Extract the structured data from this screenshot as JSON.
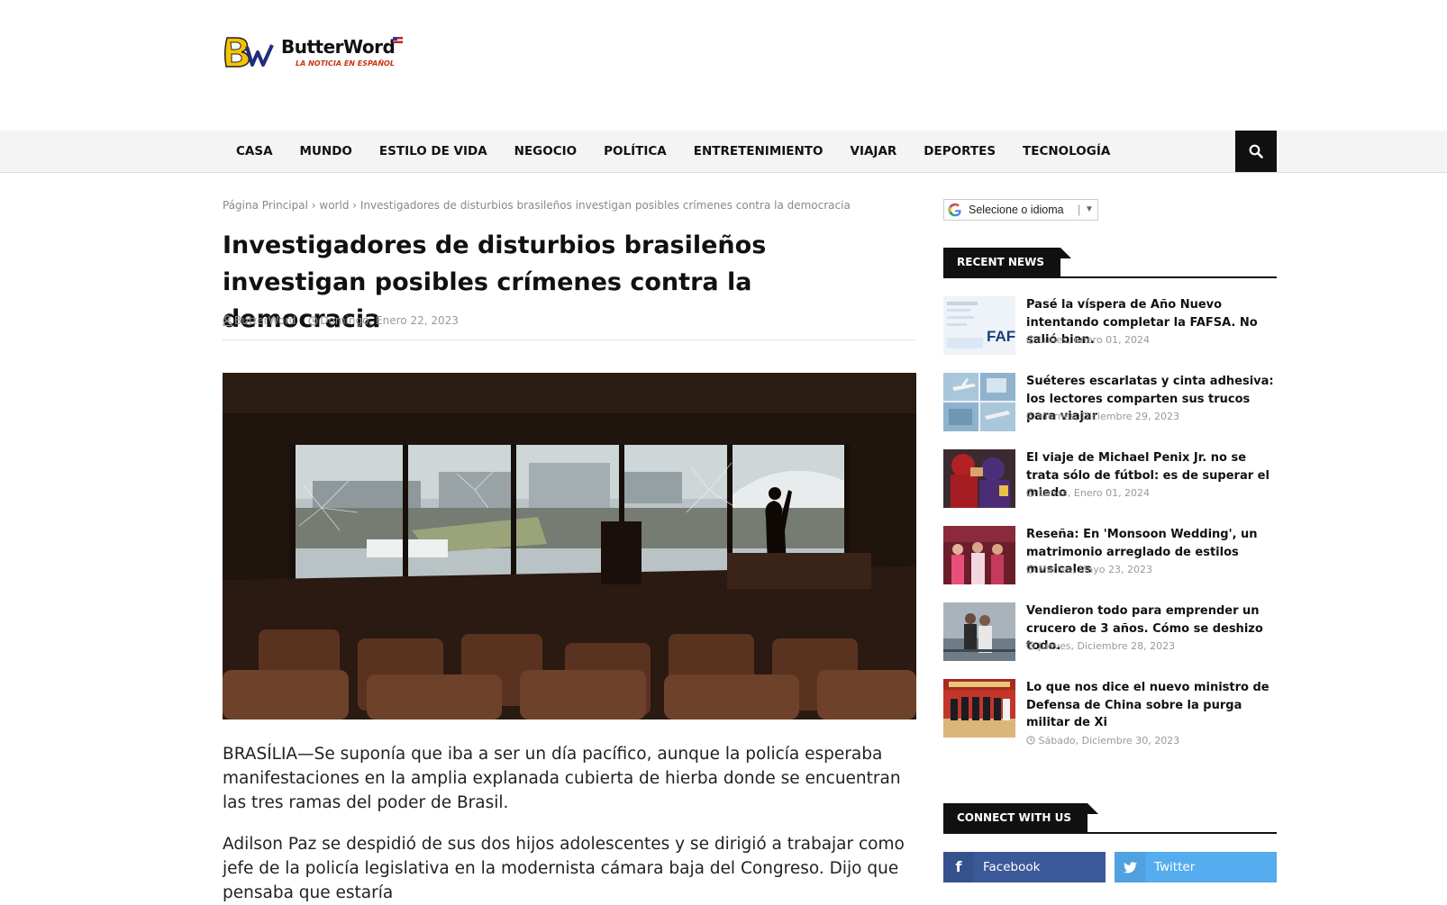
{
  "site": {
    "name": "ButterWord",
    "tagline": "LA NOTICIA EN ESPAÑOL"
  },
  "nav": {
    "items": [
      "CASA",
      "MUNDO",
      "ESTILO DE VIDA",
      "NEGOCIO",
      "POLÍTICA",
      "ENTRETENIMIENTO",
      "VIAJAR",
      "DEPORTES",
      "TECNOLOGÍA"
    ],
    "search_icon": "search-icon"
  },
  "breadcrumb": {
    "home": "Página Principal",
    "section": "world",
    "current": "Investigadores de disturbios brasileños investigan posibles crímenes contra la democracia"
  },
  "article": {
    "title": "Investigadores de disturbios brasileños investigan posibles crímenes contra la democracia",
    "author": "ButterWord",
    "date": "Domingo, Enero 22, 2023",
    "paragraphs": [
      "BRASÍLIA—Se suponía que iba a ser un día pacífico, aunque la policía esperaba manifestaciones en la amplia explanada cubierta de hierba donde se encuentran las tres ramas del poder de Brasil.",
      "Adilson Paz se despidió de sus dos hijos adolescentes y se dirigió a trabajar como jefe de la policía legislativa en la modernista cámara baja del Congreso. Dijo que pensaba que estaría"
    ]
  },
  "sidebar": {
    "translate_label": "Selecione o idioma",
    "recent_heading": "RECENT NEWS",
    "recent": [
      {
        "title": "Pasé la víspera de Año Nuevo intentando completar la FAFSA. No salió bien.",
        "date": "Lunes, Enero 01, 2024"
      },
      {
        "title": "Suéteres escarlatas y cinta adhesiva: los lectores comparten sus trucos para viajar",
        "date": "Viernes, Diciembre 29, 2023"
      },
      {
        "title": "El viaje de Michael Penix Jr. no se trata sólo de fútbol: es de superar el miedo",
        "date": "Lunes, Enero 01, 2024"
      },
      {
        "title": "Reseña: En 'Monsoon Wedding', un matrimonio arreglado de estilos musicales",
        "date": "Martes, Mayo 23, 2023"
      },
      {
        "title": "Vendieron todo para emprender un crucero de 3 años. Cómo se deshizo todo.",
        "date": "Jueves, Diciembre 28, 2023"
      },
      {
        "title": "Lo que nos dice el nuevo ministro de Defensa de China sobre la purga militar de Xi",
        "date": "Sábado, Diciembre 30, 2023"
      }
    ],
    "thumb_text": "FAFS",
    "connect_heading": "CONNECT WITH US",
    "social": [
      {
        "label": "Facebook",
        "color": "#3b5998"
      },
      {
        "label": "Twitter",
        "color": "#55acee"
      }
    ]
  },
  "colors": {
    "accent": "#111111",
    "logo_red": "#cc3311",
    "logo_yellow": "#f5c400"
  }
}
